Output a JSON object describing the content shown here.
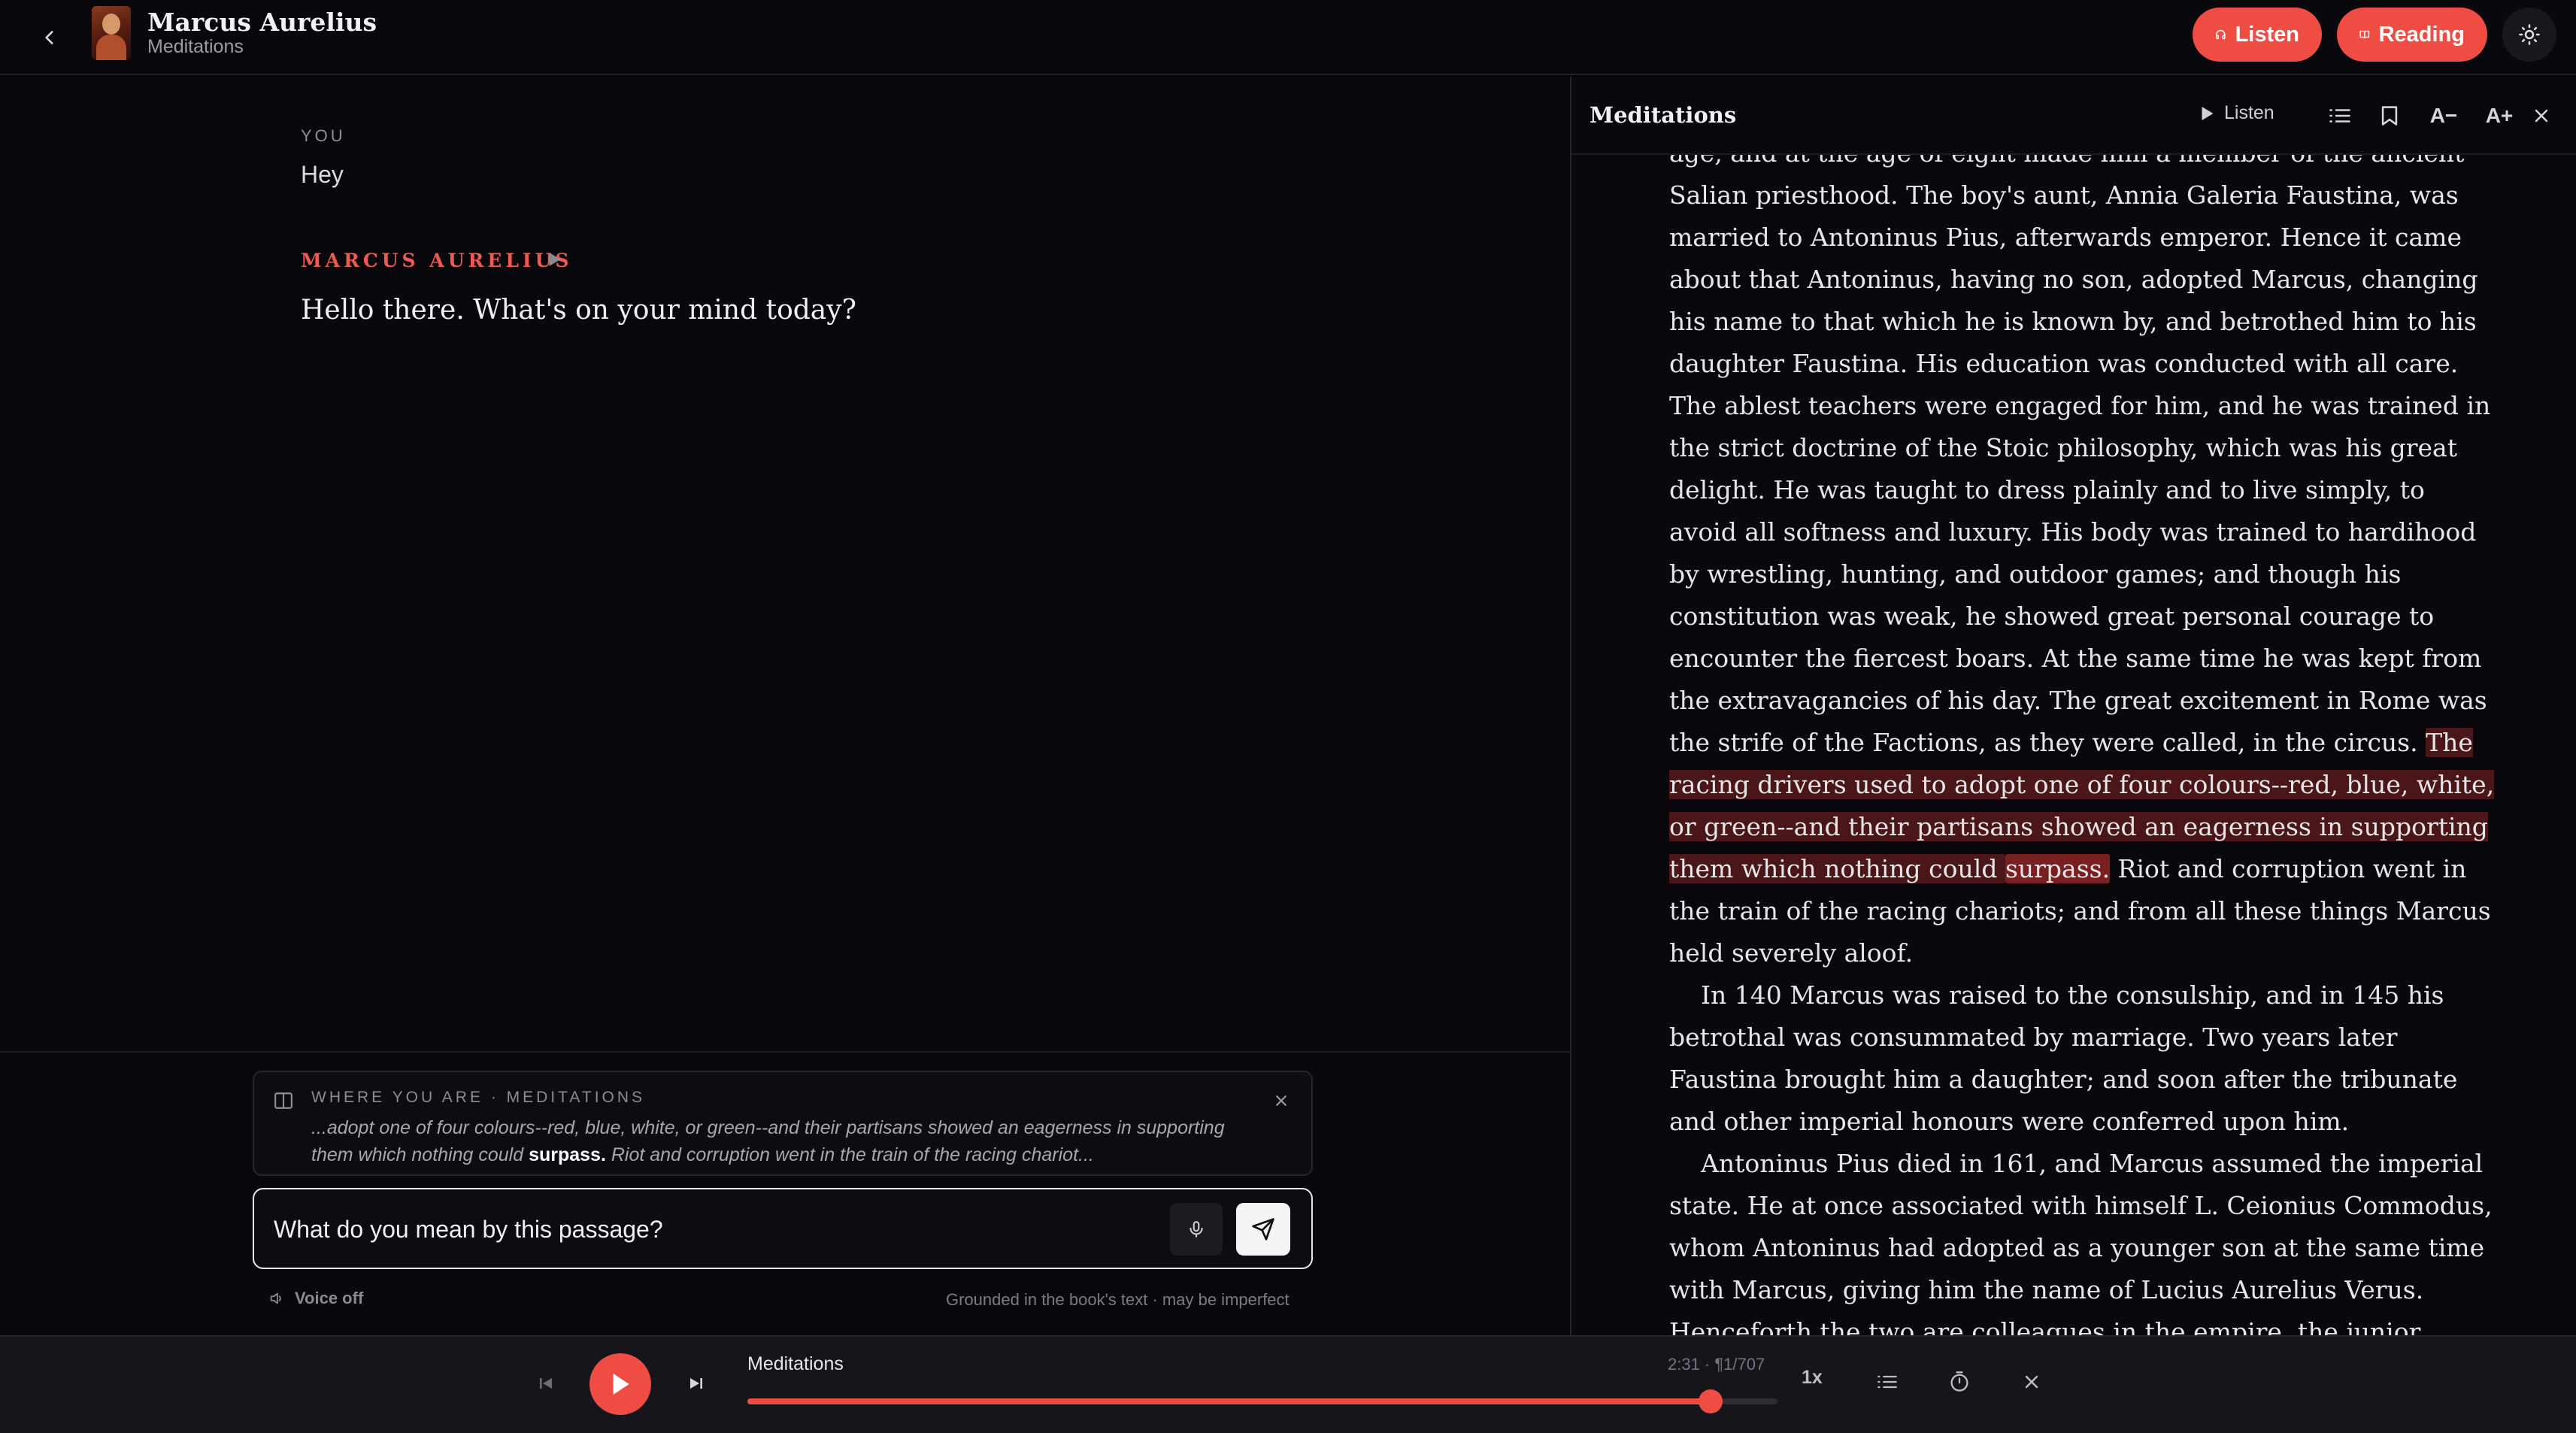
{
  "header": {
    "title": "Marcus Aurelius",
    "subtitle": "Meditations",
    "listen_label": "Listen",
    "reading_label": "Reading"
  },
  "chat": {
    "messages": [
      {
        "role": "YOU",
        "text": "Hey"
      },
      {
        "role": "MARCUS AURELIUS",
        "text": "Hello there. What's on your mind today?"
      }
    ],
    "context": {
      "label": "WHERE YOU ARE · MEDITATIONS",
      "before": "...adopt one of four colours--red, blue, white, or green--and their partisans showed an eagerness in supporting them which nothing could ",
      "focus": "surpass.",
      "after": " Riot and corruption went in the train of the racing chariot..."
    },
    "input_value": "What do you mean by this passage?",
    "voice_label": "Voice off",
    "grounded_note": "Grounded in the book's text · may be imperfect"
  },
  "reader": {
    "title": "Meditations",
    "listen_label": "Listen",
    "font_smaller": "A−",
    "font_larger": "A+",
    "text": {
      "p1_before": "age, and at the age of eight made him a member of the ancient Salian priesthood. The boy's aunt, Annia Galeria Faustina, was married to Antoninus Pius, afterwards emperor. Hence it came about that Antoninus, having no son, adopted Marcus, changing his name to that which he is known by, and betrothed him to his daughter Faustina. His education was conducted with all care. The ablest teachers were engaged for him, and he was trained in the strict doctrine of the Stoic philosophy, which was his great delight. He was taught to dress plainly and to live simply, to avoid all softness and luxury. His body was trained to hardihood by wrestling, hunting, and outdoor games; and though his constitution was weak, he showed great personal courage to encounter the fiercest boars. At the same time he was kept from the extravagancies of his day. The great excitement in Rome was the strife of the Factions, as they were called, in the circus. ",
      "p1_highlight": "The racing drivers used to adopt one of four colours--red, blue, white, or green--and their partisans showed an eagerness in supporting them which nothing could ",
      "p1_word": "surpass.",
      "p1_after": " Riot and corruption went in the train of the racing chariots; and from all these things Marcus held severely aloof.",
      "p2": "In 140 Marcus was raised to the consulship, and in 145 his betrothal was consummated by marriage. Two years later Faustina brought him a daughter; and soon after the tribunate and other imperial honours were conferred upon him.",
      "p3": "Antoninus Pius died in 161, and Marcus assumed the imperial state. He at once associated with himself L. Ceionius Commodus, whom Antoninus had adopted as a younger son at the same time with Marcus, giving him the name of Lucius Aurelius Verus. Henceforth the two are colleagues in the empire, the junior being trained as it were to succeed. No sooner was Marcus settled upon the throne than wars broke out on all sides. In the east, Vologeses III. of Parthia began a long-meditated"
    }
  },
  "player": {
    "title": "Meditations",
    "position": "2:31 · ¶1/707",
    "progress": 0.935,
    "speed": "1x"
  },
  "colors": {
    "accent": "#ef4d44",
    "background": "#09090d",
    "highlight": "#4a1617"
  },
  "icons": [
    "chevron-left-icon",
    "headphones-icon",
    "book-open-icon",
    "sun-icon",
    "play-icon",
    "list-icon",
    "bookmark-icon",
    "close-icon",
    "mic-icon",
    "send-icon",
    "speaker-icon",
    "skip-back-icon",
    "skip-forward-icon",
    "timer-icon"
  ]
}
